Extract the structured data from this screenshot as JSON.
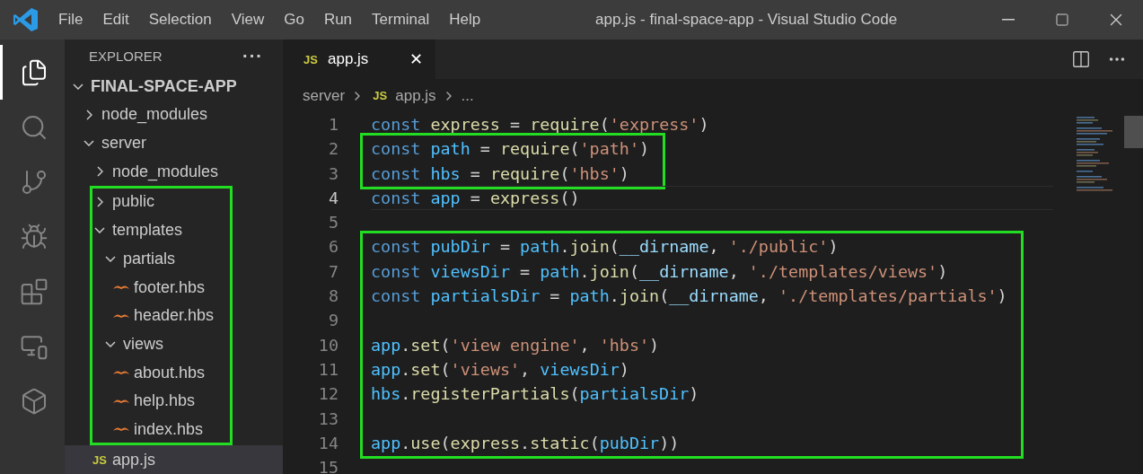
{
  "window": {
    "title": "app.js - final-space-app - Visual Studio Code"
  },
  "menu": [
    "File",
    "Edit",
    "Selection",
    "View",
    "Go",
    "Run",
    "Terminal",
    "Help"
  ],
  "activity_bar": [
    {
      "kind": "files",
      "selected": true
    },
    {
      "kind": "search",
      "selected": false
    },
    {
      "kind": "branch",
      "selected": false
    },
    {
      "kind": "debug",
      "selected": false
    },
    {
      "kind": "extensions",
      "selected": false
    },
    {
      "kind": "remote",
      "selected": false
    },
    {
      "kind": "cube",
      "selected": false
    }
  ],
  "sidebar": {
    "title": "EXPLORER",
    "more": "···",
    "root": {
      "label": "FINAL-SPACE-APP",
      "expanded": true
    },
    "items": [
      {
        "label": "node_modules",
        "kind": "folder",
        "expanded": false,
        "selected": false,
        "highlighted": false
      },
      {
        "label": "server",
        "kind": "folder",
        "expanded": true,
        "selected": false,
        "highlighted": false,
        "children": [
          {
            "label": "node_modules",
            "kind": "folder",
            "expanded": false,
            "selected": false,
            "highlighted": false
          },
          {
            "label": "public",
            "kind": "folder",
            "expanded": false,
            "selected": false,
            "highlighted": true
          },
          {
            "label": "templates",
            "kind": "folder",
            "expanded": true,
            "selected": false,
            "highlighted": true,
            "children": [
              {
                "label": "partials",
                "kind": "folder",
                "expanded": true,
                "selected": false,
                "children": [
                  {
                    "label": "footer.hbs",
                    "kind": "hbs",
                    "selected": false
                  },
                  {
                    "label": "header.hbs",
                    "kind": "hbs",
                    "selected": false
                  }
                ]
              },
              {
                "label": "views",
                "kind": "folder",
                "expanded": true,
                "selected": false,
                "children": [
                  {
                    "label": "about.hbs",
                    "kind": "hbs",
                    "selected": false
                  },
                  {
                    "label": "help.hbs",
                    "kind": "hbs",
                    "selected": false
                  },
                  {
                    "label": "index.hbs",
                    "kind": "hbs",
                    "selected": false
                  }
                ]
              }
            ]
          },
          {
            "label": "app.js",
            "kind": "js",
            "badge": "JS",
            "selected": true,
            "highlighted": false
          }
        ]
      }
    ]
  },
  "tabs": [
    {
      "label": "app.js",
      "badge": "JS",
      "selected": true,
      "close": "✕"
    }
  ],
  "breadcrumb": [
    {
      "label": "server"
    },
    {
      "label": "app.js",
      "badge": "JS"
    },
    {
      "label": "..."
    }
  ],
  "code_groups": [
    {
      "highlighted": false,
      "lines": [
        {
          "number": "1",
          "current": false,
          "tokens": [
            {
              "text": "const ",
              "kind": "keyword"
            },
            {
              "text": "express",
              "kind": "function"
            },
            {
              "text": " = ",
              "kind": "plain"
            },
            {
              "text": "require",
              "kind": "function"
            },
            {
              "text": "(",
              "kind": "plain"
            },
            {
              "text": "'express'",
              "kind": "string"
            },
            {
              "text": ")",
              "kind": "plain"
            }
          ]
        }
      ]
    },
    {
      "highlighted": true,
      "lines": [
        {
          "number": "2",
          "current": false,
          "tokens": [
            {
              "text": "const ",
              "kind": "keyword"
            },
            {
              "text": "path",
              "kind": "constant"
            },
            {
              "text": " = ",
              "kind": "plain"
            },
            {
              "text": "require",
              "kind": "function"
            },
            {
              "text": "(",
              "kind": "plain"
            },
            {
              "text": "'path'",
              "kind": "string"
            },
            {
              "text": ")",
              "kind": "plain"
            }
          ]
        },
        {
          "number": "3",
          "current": false,
          "tokens": [
            {
              "text": "const ",
              "kind": "keyword"
            },
            {
              "text": "hbs",
              "kind": "constant"
            },
            {
              "text": " = ",
              "kind": "plain"
            },
            {
              "text": "require",
              "kind": "function"
            },
            {
              "text": "(",
              "kind": "plain"
            },
            {
              "text": "'hbs'",
              "kind": "string"
            },
            {
              "text": ")",
              "kind": "plain"
            }
          ]
        }
      ]
    },
    {
      "highlighted": false,
      "lines": [
        {
          "number": "4",
          "current": true,
          "tokens": [
            {
              "text": "const ",
              "kind": "keyword"
            },
            {
              "text": "app",
              "kind": "constant"
            },
            {
              "text": " = ",
              "kind": "plain"
            },
            {
              "text": "express",
              "kind": "function"
            },
            {
              "text": "()",
              "kind": "plain"
            }
          ]
        },
        {
          "number": "5",
          "current": false
        }
      ]
    },
    {
      "highlighted": true,
      "lines": [
        {
          "number": "6",
          "current": false,
          "tokens": [
            {
              "text": "const ",
              "kind": "keyword"
            },
            {
              "text": "pubDir",
              "kind": "constant"
            },
            {
              "text": " = ",
              "kind": "plain"
            },
            {
              "text": "path",
              "kind": "constant"
            },
            {
              "text": ".",
              "kind": "plain"
            },
            {
              "text": "join",
              "kind": "function"
            },
            {
              "text": "(",
              "kind": "plain"
            },
            {
              "text": "__dirname",
              "kind": "variable"
            },
            {
              "text": ", ",
              "kind": "plain"
            },
            {
              "text": "'./public'",
              "kind": "string"
            },
            {
              "text": ")",
              "kind": "plain"
            }
          ]
        },
        {
          "number": "7",
          "current": false,
          "tokens": [
            {
              "text": "const ",
              "kind": "keyword"
            },
            {
              "text": "viewsDir",
              "kind": "constant"
            },
            {
              "text": " = ",
              "kind": "plain"
            },
            {
              "text": "path",
              "kind": "constant"
            },
            {
              "text": ".",
              "kind": "plain"
            },
            {
              "text": "join",
              "kind": "function"
            },
            {
              "text": "(",
              "kind": "plain"
            },
            {
              "text": "__dirname",
              "kind": "variable"
            },
            {
              "text": ", ",
              "kind": "plain"
            },
            {
              "text": "'./templates/views'",
              "kind": "string"
            },
            {
              "text": ")",
              "kind": "plain"
            }
          ]
        },
        {
          "number": "8",
          "current": false,
          "tokens": [
            {
              "text": "const ",
              "kind": "keyword"
            },
            {
              "text": "partialsDir",
              "kind": "constant"
            },
            {
              "text": " = ",
              "kind": "plain"
            },
            {
              "text": "path",
              "kind": "constant"
            },
            {
              "text": ".",
              "kind": "plain"
            },
            {
              "text": "join",
              "kind": "function"
            },
            {
              "text": "(",
              "kind": "plain"
            },
            {
              "text": "__dirname",
              "kind": "variable"
            },
            {
              "text": ", ",
              "kind": "plain"
            },
            {
              "text": "'./templates/partials'",
              "kind": "string"
            },
            {
              "text": ")",
              "kind": "plain"
            }
          ]
        },
        {
          "number": "9",
          "current": false
        },
        {
          "number": "10",
          "current": false,
          "tokens": [
            {
              "text": "app",
              "kind": "constant"
            },
            {
              "text": ".",
              "kind": "plain"
            },
            {
              "text": "set",
              "kind": "function"
            },
            {
              "text": "(",
              "kind": "plain"
            },
            {
              "text": "'view engine'",
              "kind": "string"
            },
            {
              "text": ", ",
              "kind": "plain"
            },
            {
              "text": "'hbs'",
              "kind": "string"
            },
            {
              "text": ")",
              "kind": "plain"
            }
          ]
        },
        {
          "number": "11",
          "current": false,
          "tokens": [
            {
              "text": "app",
              "kind": "constant"
            },
            {
              "text": ".",
              "kind": "plain"
            },
            {
              "text": "set",
              "kind": "function"
            },
            {
              "text": "(",
              "kind": "plain"
            },
            {
              "text": "'views'",
              "kind": "string"
            },
            {
              "text": ", ",
              "kind": "plain"
            },
            {
              "text": "viewsDir",
              "kind": "constant"
            },
            {
              "text": ")",
              "kind": "plain"
            }
          ]
        },
        {
          "number": "12",
          "current": false,
          "tokens": [
            {
              "text": "hbs",
              "kind": "constant"
            },
            {
              "text": ".",
              "kind": "plain"
            },
            {
              "text": "registerPartials",
              "kind": "function"
            },
            {
              "text": "(",
              "kind": "plain"
            },
            {
              "text": "partialsDir",
              "kind": "constant"
            },
            {
              "text": ")",
              "kind": "plain"
            }
          ]
        },
        {
          "number": "13",
          "current": false
        },
        {
          "number": "14",
          "current": false,
          "tokens": [
            {
              "text": "app",
              "kind": "constant"
            },
            {
              "text": ".",
              "kind": "plain"
            },
            {
              "text": "use",
              "kind": "function"
            },
            {
              "text": "(",
              "kind": "plain"
            },
            {
              "text": "express",
              "kind": "function"
            },
            {
              "text": ".",
              "kind": "plain"
            },
            {
              "text": "static",
              "kind": "function"
            },
            {
              "text": "(",
              "kind": "plain"
            },
            {
              "text": "pubDir",
              "kind": "constant"
            },
            {
              "text": "))",
              "kind": "plain"
            }
          ]
        }
      ]
    },
    {
      "highlighted": false,
      "lines": [
        {
          "number": "15",
          "current": false
        }
      ]
    }
  ]
}
